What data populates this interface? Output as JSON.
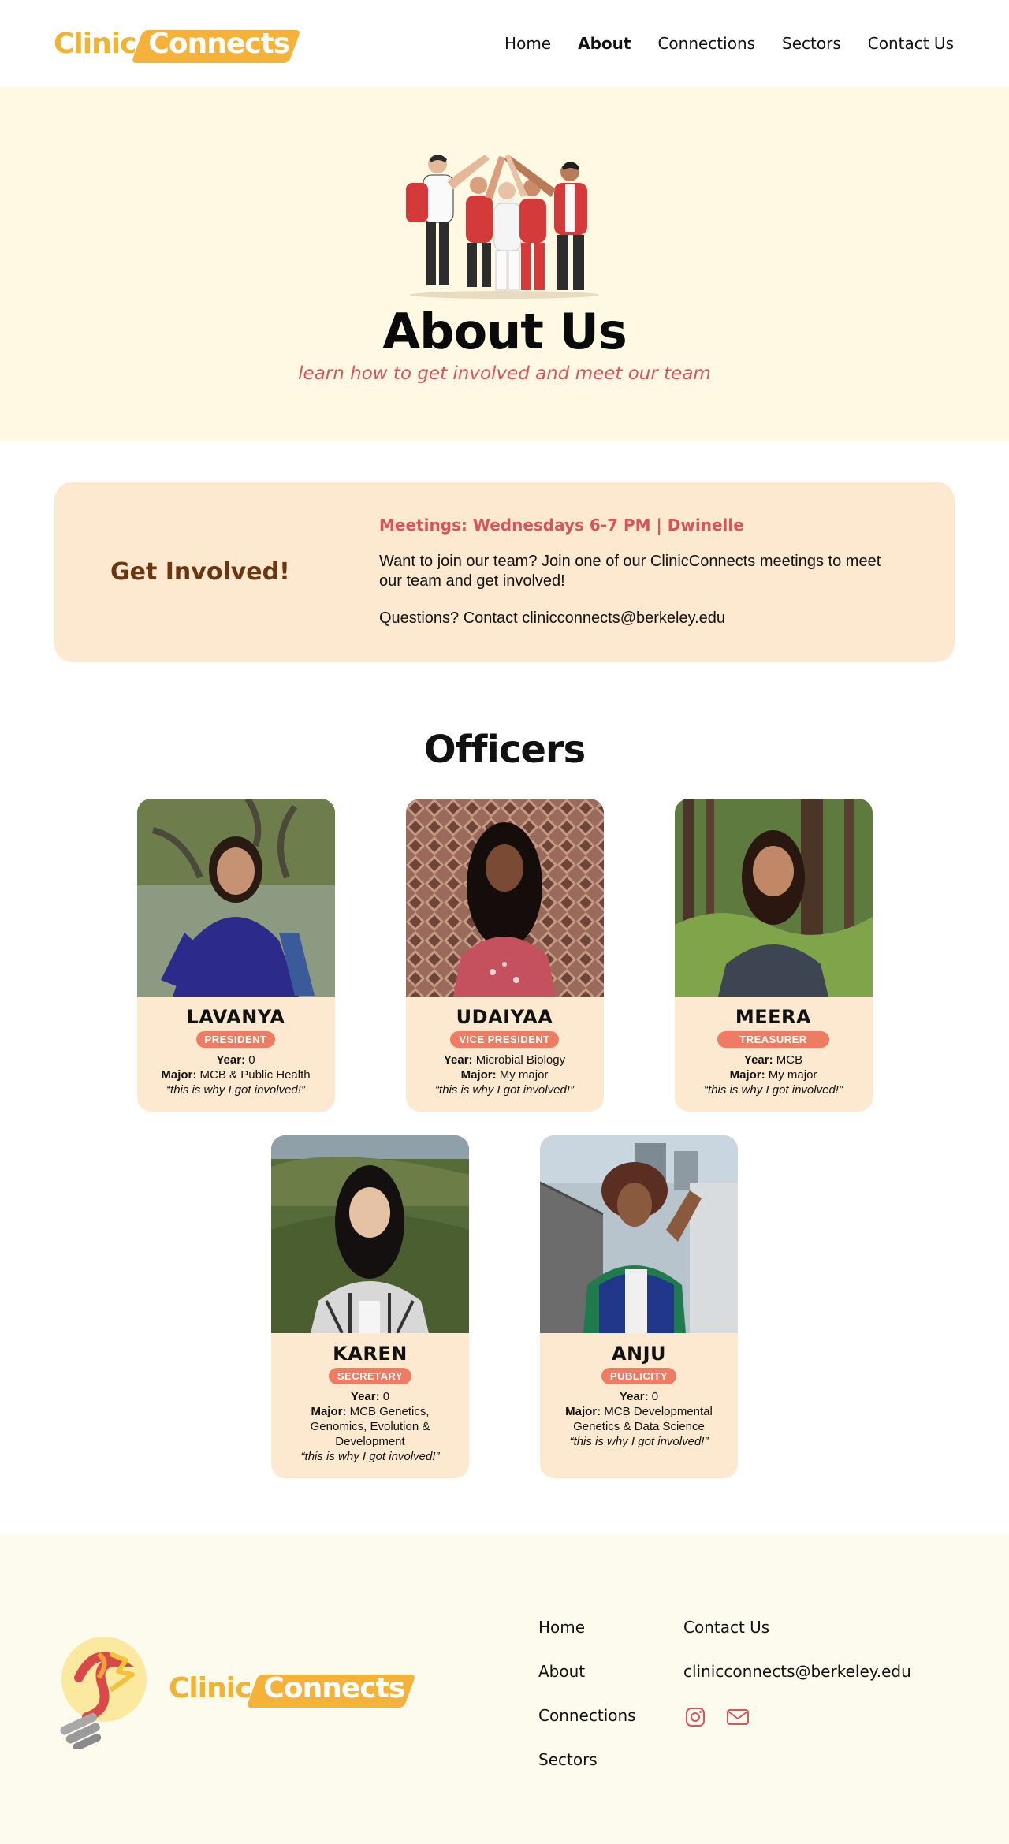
{
  "header": {
    "logo_word1": "Clinic",
    "logo_word2": "Connects",
    "nav": [
      "Home",
      "About",
      "Connections",
      "Sectors",
      "Contact Us"
    ],
    "active": "About"
  },
  "hero": {
    "title": "About Us",
    "subtitle": "learn how to get involved and meet our team"
  },
  "involved": {
    "title": "Get Involved!",
    "meetings": "Meetings: Wednesdays 6-7 PM | Dwinelle",
    "text": "Want to join our team? Join one of our ClinicConnects meetings to meet our team and get involved!",
    "questions": "Questions? Contact clinicconnects@berkeley.edu"
  },
  "officers": {
    "title": "Officers",
    "year_label": "Year:",
    "major_label": "Major:",
    "members": [
      {
        "name": "LAVANYA",
        "role": "PRESIDENT",
        "year": "0",
        "major": "MCB & Public Health",
        "quote": "“this is why I got involved!”"
      },
      {
        "name": "UDAIYAA",
        "role": "VICE PRESIDENT",
        "year": "Microbial Biology",
        "major": "My major",
        "quote": "“this is why I got involved!”"
      },
      {
        "name": "MEERA",
        "role": "TREASURER",
        "year": "MCB",
        "major": "My major",
        "quote": "“this is why I got involved!”"
      },
      {
        "name": "KAREN",
        "role": "SECRETARY",
        "year": "0",
        "major": "MCB Genetics, Genomics, Evolution & Development",
        "quote": "“this is why I got involved!”"
      },
      {
        "name": "ANJU",
        "role": "PUBLICITY",
        "year": "0",
        "major": "MCB Developmental Genetics & Data Science",
        "quote": "“this is why I got involved!”"
      }
    ]
  },
  "footer": {
    "links": [
      "Home",
      "About",
      "Connections",
      "Sectors"
    ],
    "contact_label": "Contact Us",
    "email": "clinicconnects@berkeley.edu",
    "icons": [
      "instagram-icon",
      "mail-icon"
    ]
  },
  "colors": {
    "brand_yellow": "#f4b23a",
    "accent_red": "#d9535a",
    "hero_bg": "#fff8e2",
    "card_bg": "#fde9d0",
    "role_badge": "#ee7c62",
    "involved_title": "#6b3510"
  }
}
